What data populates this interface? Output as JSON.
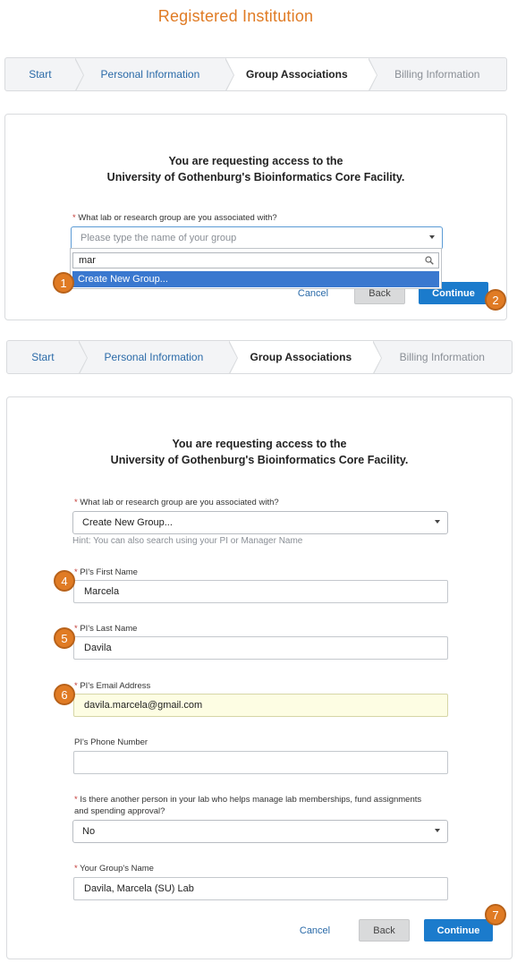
{
  "page_title": "Registered Institution",
  "steps": [
    {
      "label": "Start",
      "state": "done"
    },
    {
      "label": "Personal Information",
      "state": "done"
    },
    {
      "label": "Group Associations",
      "state": "active"
    },
    {
      "label": "Billing Information",
      "state": "disabled"
    }
  ],
  "request": {
    "line1": "You are requesting access to the",
    "line2": "University of Gothenburg's Bioinformatics Core Facility."
  },
  "group_question": {
    "required": "*",
    "label": " What lab or research group are you associated with?"
  },
  "panel1": {
    "select_placeholder": "Please type the name of your group",
    "search_value": "mar",
    "dropdown_option": "Create New Group..."
  },
  "panel2": {
    "select_value": "Create New Group...",
    "hint": "Hint: You can also search using your PI or Manager Name",
    "pi_first_label": " PI's First Name",
    "pi_first_value": "Marcela",
    "pi_last_label": " PI's Last Name",
    "pi_last_value": "Davila",
    "pi_email_label": " PI's Email Address",
    "pi_email_value": "davila.marcela@gmail.com",
    "pi_phone_label": "PI's Phone Number",
    "pi_phone_value": "",
    "manager_q_line1": " Is there another person in your lab who helps manage lab memberships, fund assignments",
    "manager_q_line2": "and spending approval?",
    "manager_value": "No",
    "group_name_label": " Your Group's Name",
    "group_name_value": "Davila, Marcela (SU) Lab"
  },
  "buttons": {
    "cancel": "Cancel",
    "back": "Back",
    "continue": "Continue"
  },
  "badges": [
    "1",
    "2",
    "4",
    "5",
    "6",
    "7"
  ],
  "colors": {
    "accent": "#e07b24",
    "primary": "#1b7bcc",
    "highlight": "#3a78cf",
    "autofill": "#fdfde3"
  },
  "icons": {
    "search": "search-icon",
    "caret": "chevron-down-icon"
  }
}
